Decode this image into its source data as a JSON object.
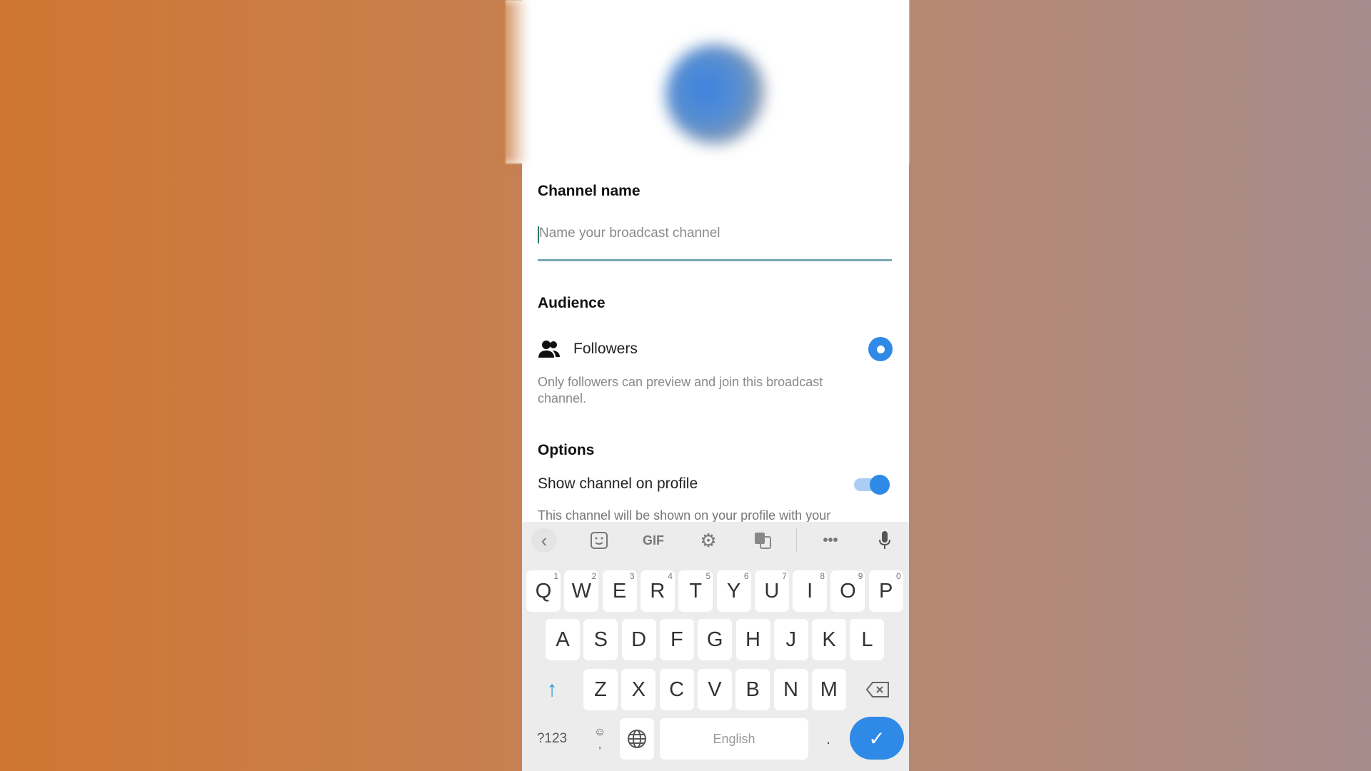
{
  "form": {
    "channel_name_label": "Channel name",
    "channel_name_placeholder": "Name your broadcast channel",
    "channel_name_value": "",
    "audience_label": "Audience",
    "audience_option": "Followers",
    "audience_selected": true,
    "audience_description": "Only followers can preview and join this broadcast channel.",
    "options_label": "Options",
    "show_on_profile_label": "Show channel on profile",
    "show_on_profile_enabled": true,
    "show_on_profile_description": "This channel will be shown on your profile with your"
  },
  "keyboard": {
    "toolbar": {
      "gif": "GIF"
    },
    "row1": [
      {
        "k": "Q",
        "n": "1"
      },
      {
        "k": "W",
        "n": "2"
      },
      {
        "k": "E",
        "n": "3"
      },
      {
        "k": "R",
        "n": "4"
      },
      {
        "k": "T",
        "n": "5"
      },
      {
        "k": "Y",
        "n": "6"
      },
      {
        "k": "U",
        "n": "7"
      },
      {
        "k": "I",
        "n": "8"
      },
      {
        "k": "O",
        "n": "9"
      },
      {
        "k": "P",
        "n": "0"
      }
    ],
    "row2": [
      "A",
      "S",
      "D",
      "F",
      "G",
      "H",
      "J",
      "K",
      "L"
    ],
    "row3": [
      "Z",
      "X",
      "C",
      "V",
      "B",
      "N",
      "M"
    ],
    "symbols": "?123",
    "comma": ",",
    "period": ".",
    "space": "English",
    "accent": "#2e8ae6"
  }
}
